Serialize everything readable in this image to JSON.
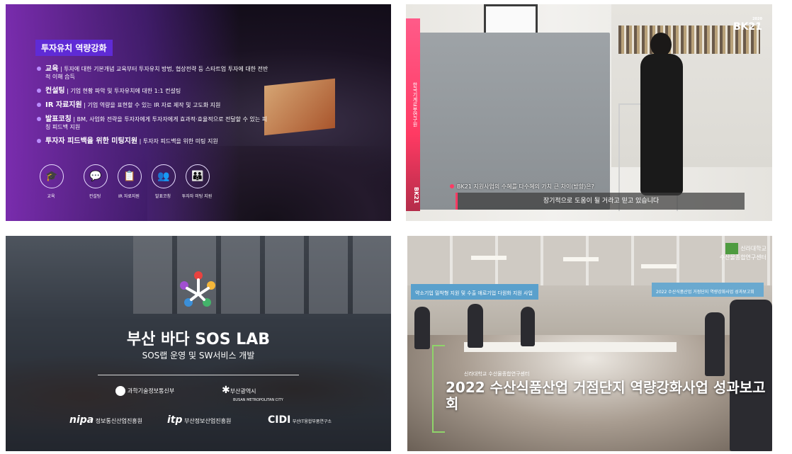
{
  "panel1": {
    "title": "투자유치 역량강화",
    "items": [
      {
        "head": "교육",
        "text": "투자에 대한 기본개념 교육부터 투자유치 방법, 협상전략 등 스타트업 투자에 대한 전반적 이해 습득"
      },
      {
        "head": "컨설팅",
        "text": "기업 현황 파악 및 투자유치에 대한 1:1 컨설팅"
      },
      {
        "head": "IR 자료지원",
        "text": "기업 역량을 표현할 수 있는 IR 자료 제작 및 고도화 지원"
      },
      {
        "head": "발표코칭",
        "text": "BM, 사업화 전략을 투자자에게 투자자에게 효과적·효율적으로 전달할 수 있는 피칭 피드백 지원"
      },
      {
        "head": "투자자 피드백을 위한 미팅지원",
        "text": "투자자 피드백을 위한 미팅 지원"
      }
    ],
    "icons": [
      {
        "label": "교육",
        "icon": "graduation-cap-icon",
        "glyph": "🎓"
      },
      {
        "label": "컨설팅",
        "icon": "chat-icon",
        "glyph": "💬"
      },
      {
        "label": "IR 자료지원",
        "icon": "document-icon",
        "glyph": "📋"
      },
      {
        "label": "발표코칭",
        "icon": "presenter-icon",
        "glyph": "👥"
      },
      {
        "label": "투자자 미팅 지원",
        "icon": "meeting-icon",
        "glyph": "👪"
      }
    ]
  },
  "panel2": {
    "vertical_text": "한국기계로봇연구원",
    "strip_label": "BK21",
    "logo": "BK21",
    "logo_small": "2020",
    "question": "BK21 지원사업의 수혜를 다수혜의 가치 큰 차이(방향)은?",
    "caption": "장기적으로 도움이 될 거라고 믿고 있습니다",
    "accent": "#ff3a63"
  },
  "panel3": {
    "title": "부산 바다 SOS LAB",
    "subtitle": "SOS랩 운영 및 SW서비스 개발",
    "org1": "과학기술정보통신부",
    "org2": "부산광역시",
    "org2_small": "BUSAN METROPOLITAN CITY",
    "org3_logo": "nipa",
    "org3": "정보통신산업진흥원",
    "org4_logo": "itp",
    "org4": "부산정보산업진흥원",
    "org5_logo": "CIDI",
    "org5": "부산IT융합부품연구소"
  },
  "panel4": {
    "banner_left": "약소기업 밀착형 지원 및 수출 애로기업 다원화 지원 사업",
    "banner_right": "2022 수산식품산업 거점단지 역량강화사업 성과보고회",
    "logo_line1": "신라대학교",
    "logo_line2": "수산물종합연구센터",
    "subtitle": "신라대학교 수산물종합연구센터",
    "title": "2022 수산식품산업 거점단지 역량강화사업 성과보고회",
    "accent": "#8fd46a"
  }
}
